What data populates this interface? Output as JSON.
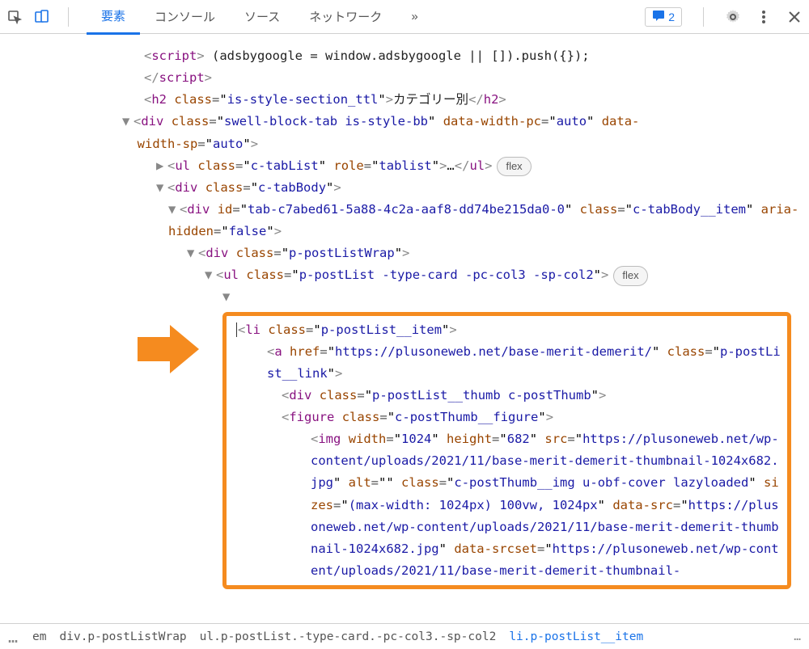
{
  "toolbar": {
    "tabs": [
      "要素",
      "コンソール",
      "ソース",
      "ネットワーク"
    ],
    "more": "»",
    "issues_count": "2"
  },
  "code": {
    "script_text": " (adsbygoogle = window.adsbygoogle || []).push({});",
    "h2_class": "is-style-section_ttl",
    "h2_text": "カテゴリー別",
    "div_tab_class": "swell-block-tab is-style-bb",
    "div_tab_pc": "auto",
    "div_tab_sp": "auto",
    "ul_tablist_class": "c-tabList",
    "ul_tablist_role": "tablist",
    "div_tabbody_class": "c-tabBody",
    "div_tabitem_id": "tab-c7abed61-5a88-4c2a-aaf8-dd74be215da0-0",
    "div_tabitem_class": "c-tabBody__item",
    "div_tabitem_hidden": "false",
    "div_postwrap_class": "p-postListWrap",
    "ul_postlist_class": "p-postList -type-card -pc-col3 -sp-col2",
    "li_class": "p-postList__item",
    "a_href": "https://plusoneweb.net/base-merit-demerit/",
    "a_class": "p-postList__link",
    "div_thumb_class": "p-postList__thumb c-postThumb",
    "figure_class": "c-postThumb__figure",
    "img_width": "1024",
    "img_height": "682",
    "img_src": "https://plusoneweb.net/wp-content/uploads/2021/11/base-merit-demerit-thumbnail-1024x682.jpg",
    "img_alt": "",
    "img_class": "c-postThumb__img u-obf-cover lazyloaded",
    "img_sizes": "(max-width: 1024px) 100vw, 1024px",
    "img_datasrc": "https://plusoneweb.net/wp-content/uploads/2021/11/base-merit-demerit-thumbnail-1024x682.jpg",
    "img_datasrcset": "https://plusoneweb.net/wp-content/uploads/2021/11/base-merit-demerit-thumbnail-",
    "flex_label": "flex"
  },
  "breadcrumb": {
    "c0": "…",
    "c1": "em",
    "c2": "div.p-postListWrap",
    "c3": "ul.p-postList.-type-card.-pc-col3.-sp-col2",
    "c4": "li.p-postList__item",
    "trail": "…"
  }
}
